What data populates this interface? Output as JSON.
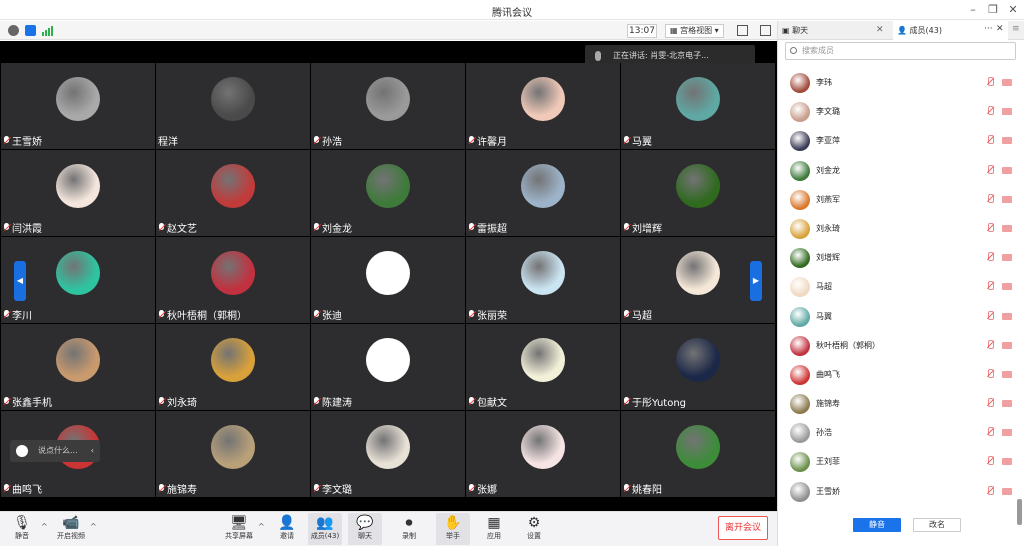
{
  "window": {
    "title": "腾讯会议"
  },
  "infobar": {
    "time": "13:07",
    "view_label": "宫格视图"
  },
  "speaker_bar": {
    "text": "正在讲话: 肖雯-北京电子..."
  },
  "grid": {
    "tiles": [
      {
        "name": "王雪娇",
        "muted": true,
        "color": "#a9a9a9"
      },
      {
        "name": "程洋",
        "muted": false,
        "color": "#4a4a4a"
      },
      {
        "name": "孙浩",
        "muted": true,
        "color": "#9a9a9a"
      },
      {
        "name": "许馨月",
        "muted": true,
        "color": "#f1c9b8"
      },
      {
        "name": "马翼",
        "muted": true,
        "color": "#5fa8a3"
      },
      {
        "name": "闫洪霞",
        "muted": true,
        "color": "#f4e6dc"
      },
      {
        "name": "赵文艺",
        "muted": true,
        "color": "#c23b3b"
      },
      {
        "name": "刘金龙",
        "muted": true,
        "color": "#3e7a3a"
      },
      {
        "name": "雷振超",
        "muted": true,
        "color": "#9db3c9"
      },
      {
        "name": "刘增辉",
        "muted": true,
        "color": "#2f6a1f"
      },
      {
        "name": "李川",
        "muted": true,
        "color": "#2ec4a0"
      },
      {
        "name": "秋叶梧桐（郭桐）",
        "muted": true,
        "color": "#c2313f"
      },
      {
        "name": "张迪",
        "muted": true,
        "color": "#ffffff"
      },
      {
        "name": "张丽荣",
        "muted": true,
        "color": "#cbe4f2"
      },
      {
        "name": "马超",
        "muted": true,
        "color": "#f5e8d8"
      },
      {
        "name": "张鑫手机",
        "muted": true,
        "color": "#c99a6e"
      },
      {
        "name": "刘永琦",
        "muted": true,
        "color": "#d8a13a"
      },
      {
        "name": "陈建涛",
        "muted": true,
        "color": "#ffffff"
      },
      {
        "name": "包献文",
        "muted": true,
        "color": "#f3f0d9"
      },
      {
        "name": "于彤Yutong",
        "muted": true,
        "color": "#1c2847"
      },
      {
        "name": "曲鸣飞",
        "muted": true,
        "color": "#cc3333"
      },
      {
        "name": "施锦寿",
        "muted": true,
        "color": "#b8a079"
      },
      {
        "name": "李文璐",
        "muted": true,
        "color": "#e8e1d6"
      },
      {
        "name": "张娜",
        "muted": true,
        "color": "#f6e4e4"
      },
      {
        "name": "姚春阳",
        "muted": true,
        "color": "#3d8c3a"
      }
    ],
    "chat_hint": "说点什么..."
  },
  "toolbar": {
    "mute": "静音",
    "video": "开启视频",
    "share": "共享屏幕",
    "invite": "邀请",
    "members": "成员(43)",
    "chat": "聊天",
    "record": "录制",
    "raise_hand": "举手",
    "apps": "应用",
    "settings": "设置",
    "leave": "离开会议"
  },
  "panel": {
    "tab_chat": "聊天",
    "tab_members": "成员(43)",
    "search_placeholder": "搜索成员",
    "members": [
      {
        "name": "李玮",
        "color": "#a04a3a"
      },
      {
        "name": "李文璐",
        "color": "#c69c8a"
      },
      {
        "name": "李亚萍",
        "color": "#3a3a55"
      },
      {
        "name": "刘金龙",
        "color": "#3e7a3a"
      },
      {
        "name": "刘燕军",
        "color": "#d9772a"
      },
      {
        "name": "刘永琦",
        "color": "#d8a13a"
      },
      {
        "name": "刘增辉",
        "color": "#2f6a1f"
      },
      {
        "name": "马超",
        "color": "#f0d8c0"
      },
      {
        "name": "马翼",
        "color": "#5fa8a3"
      },
      {
        "name": "秋叶梧桐（郭桐）",
        "color": "#c2313f"
      },
      {
        "name": "曲鸣飞",
        "color": "#cc3333"
      },
      {
        "name": "施锦寿",
        "color": "#8a7a4e"
      },
      {
        "name": "孙浩",
        "color": "#9a9a9a"
      },
      {
        "name": "王刘菲",
        "color": "#6a8f4a"
      },
      {
        "name": "王雪娇",
        "color": "#8f8f8f"
      }
    ],
    "mute_all": "静音",
    "rename": "改名"
  }
}
